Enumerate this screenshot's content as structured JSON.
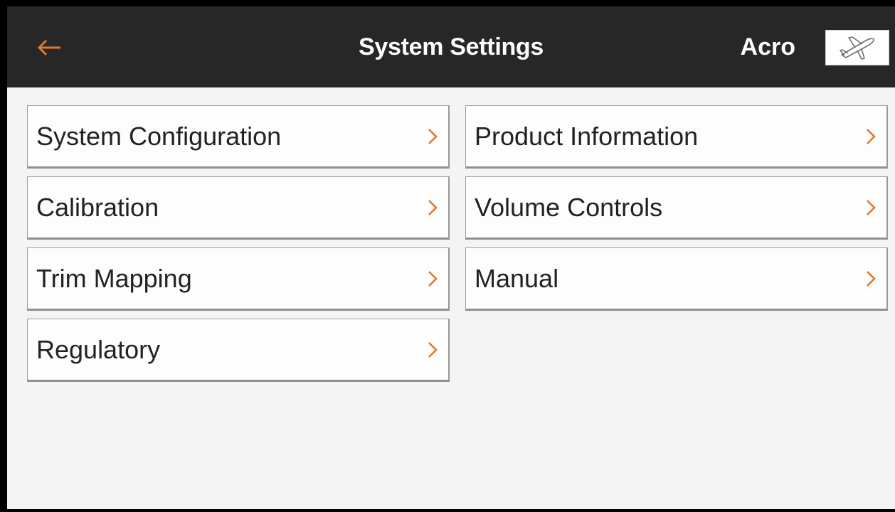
{
  "header": {
    "title": "System Settings",
    "model_name": "Acro",
    "accent_color": "#e07a2a",
    "background_color": "#272727",
    "back_icon": "arrow-left-icon",
    "model_icon": "airplane-icon"
  },
  "menu": {
    "left": [
      {
        "label": "System Configuration"
      },
      {
        "label": "Calibration"
      },
      {
        "label": "Trim Mapping"
      },
      {
        "label": "Regulatory"
      }
    ],
    "right": [
      {
        "label": "Product Information"
      },
      {
        "label": "Volume Controls"
      },
      {
        "label": "Manual"
      }
    ],
    "chevron_icon": "chevron-right-icon",
    "chevron_color": "#e07a2a"
  }
}
